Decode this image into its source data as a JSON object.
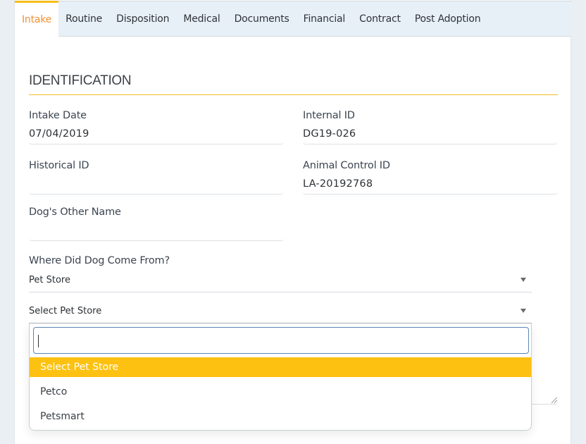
{
  "tabs": [
    {
      "label": "Intake",
      "active": true
    },
    {
      "label": "Routine",
      "active": false
    },
    {
      "label": "Disposition",
      "active": false
    },
    {
      "label": "Medical",
      "active": false
    },
    {
      "label": "Documents",
      "active": false
    },
    {
      "label": "Financial",
      "active": false
    },
    {
      "label": "Contract",
      "active": false
    },
    {
      "label": "Post Adoption",
      "active": false
    }
  ],
  "section": {
    "title": "IDENTIFICATION"
  },
  "fields": {
    "intake_date": {
      "label": "Intake Date",
      "value": "07/04/2019"
    },
    "internal_id": {
      "label": "Internal ID",
      "value": "DG19-026"
    },
    "historical_id": {
      "label": "Historical ID",
      "value": ""
    },
    "animal_control_id": {
      "label": "Animal Control ID",
      "value": "LA-20192768"
    },
    "other_name": {
      "label": "Dog's Other Name",
      "value": ""
    }
  },
  "origin": {
    "label": "Where Did Dog Come From?",
    "selected": "Pet Store"
  },
  "pet_store": {
    "selected": "Select Pet Store",
    "search_value": "",
    "options": [
      {
        "label": "Select Pet Store",
        "highlighted": true
      },
      {
        "label": "Petco",
        "highlighted": false
      },
      {
        "label": "Petsmart",
        "highlighted": false
      }
    ]
  },
  "colors": {
    "accent_orange": "#f4912f",
    "accent_yellow": "#fdc111",
    "tab_bar_bg": "#e8f0f7",
    "page_bg": "#e9eff3"
  }
}
